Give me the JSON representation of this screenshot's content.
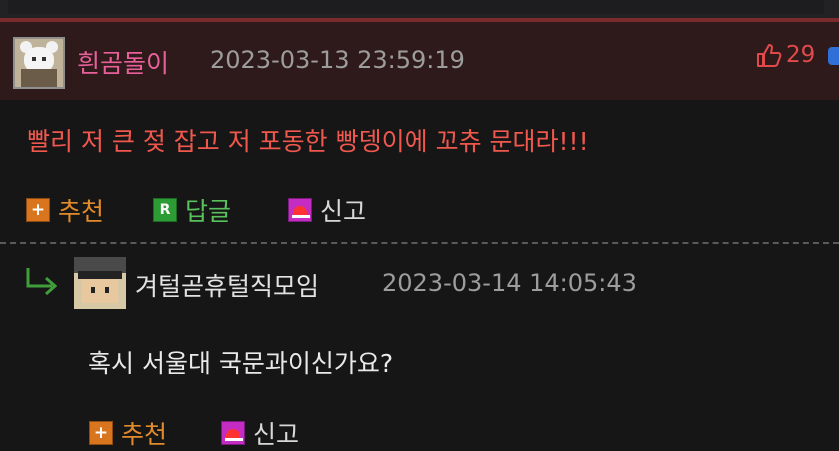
{
  "comments": [
    {
      "nickname": "흰곰돌이",
      "date": "2023-03-13 23:59:19",
      "likes": "29",
      "text": "빨리 저 큰 젖 잡고 저 포동한 빵뎅이에 꼬츄 문대라!!!",
      "actions": {
        "recommend": "추천",
        "reply": "답글",
        "report": "신고"
      },
      "colors": {
        "nickname": "#e8609a",
        "text": "#f0584e",
        "header_bg": "#2f1a1b"
      }
    },
    {
      "nickname": "겨털곧휴털직모임",
      "date": "2023-03-14 14:05:43",
      "text": "혹시 서울대 국문과이신가요?",
      "actions": {
        "recommend": "추천",
        "report": "신고"
      },
      "colors": {
        "nickname": "#e2e2e2",
        "text": "#e9e9e9"
      }
    }
  ],
  "icons": {
    "like": "thumbs-up-icon",
    "recommend": "plus-icon",
    "reply": "reply-r-icon",
    "report": "siren-icon",
    "nested": "reply-arrow-icon"
  },
  "reply_icon_letter": "R",
  "plus_glyph": "+"
}
